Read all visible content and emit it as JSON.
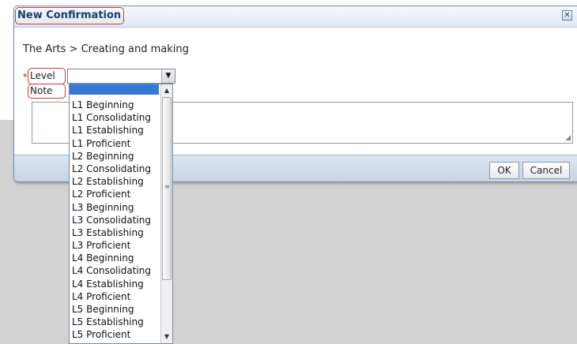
{
  "dialog": {
    "title": "New Confirmation",
    "close_icon": "close-icon",
    "breadcrumb": "The Arts > Creating and making",
    "required_marker": "*",
    "level_label": "Level",
    "level_value": "",
    "note_label": "Note",
    "note_value": "",
    "ok_label": "OK",
    "cancel_label": "Cancel"
  },
  "dropdown": {
    "options": [
      "L1 Beginning",
      "L1 Consolidating",
      "L1 Establishing",
      "L1 Proficient",
      "L2 Beginning",
      "L2 Consolidating",
      "L2 Establishing",
      "L2 Proficient",
      "L3 Beginning",
      "L3 Consolidating",
      "L3 Establishing",
      "L3 Proficient",
      "L4 Beginning",
      "L4 Consolidating",
      "L4 Establishing",
      "L4 Proficient",
      "L5 Beginning",
      "L5 Establishing",
      "L5 Proficient"
    ]
  },
  "colors": {
    "highlight": "#3479d7",
    "annotation": "#e0302f",
    "title_text": "#1c3e66"
  }
}
